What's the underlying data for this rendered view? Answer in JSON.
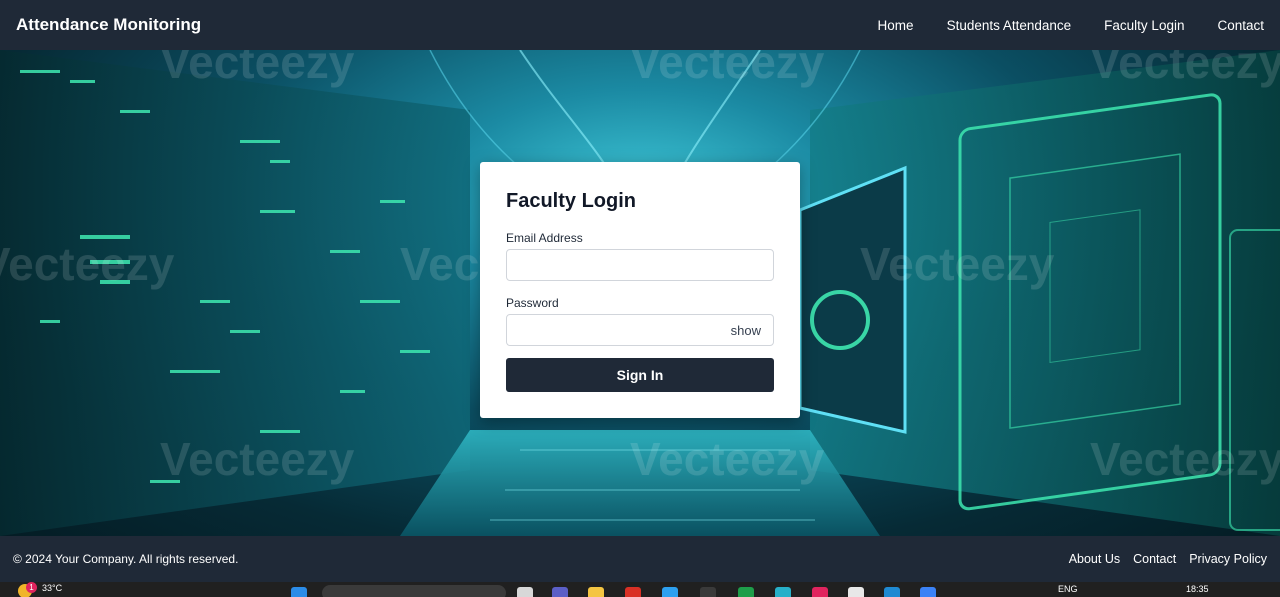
{
  "navbar": {
    "brand": "Attendance Monitoring",
    "links": [
      "Home",
      "Students Attendance",
      "Faculty Login",
      "Contact"
    ]
  },
  "login": {
    "title": "Faculty Login",
    "email_label": "Email Address",
    "email_value": "",
    "password_label": "Password",
    "password_value": "",
    "show_label": "show",
    "submit_label": "Sign In"
  },
  "footer": {
    "copyright": "© 2024 Your Company. All rights reserved.",
    "links": [
      "About Us",
      "Contact",
      "Privacy Policy"
    ]
  },
  "taskbar": {
    "weather_badge": "1",
    "temperature": "33°C",
    "language": "ENG",
    "time": "18:35"
  },
  "colors": {
    "navbar_bg": "#1f2937",
    "card_bg": "#ffffff",
    "button_bg": "#1f2937",
    "hero_accent": "#3ee8b0"
  },
  "hero": {
    "watermark": "Vecteezy"
  }
}
